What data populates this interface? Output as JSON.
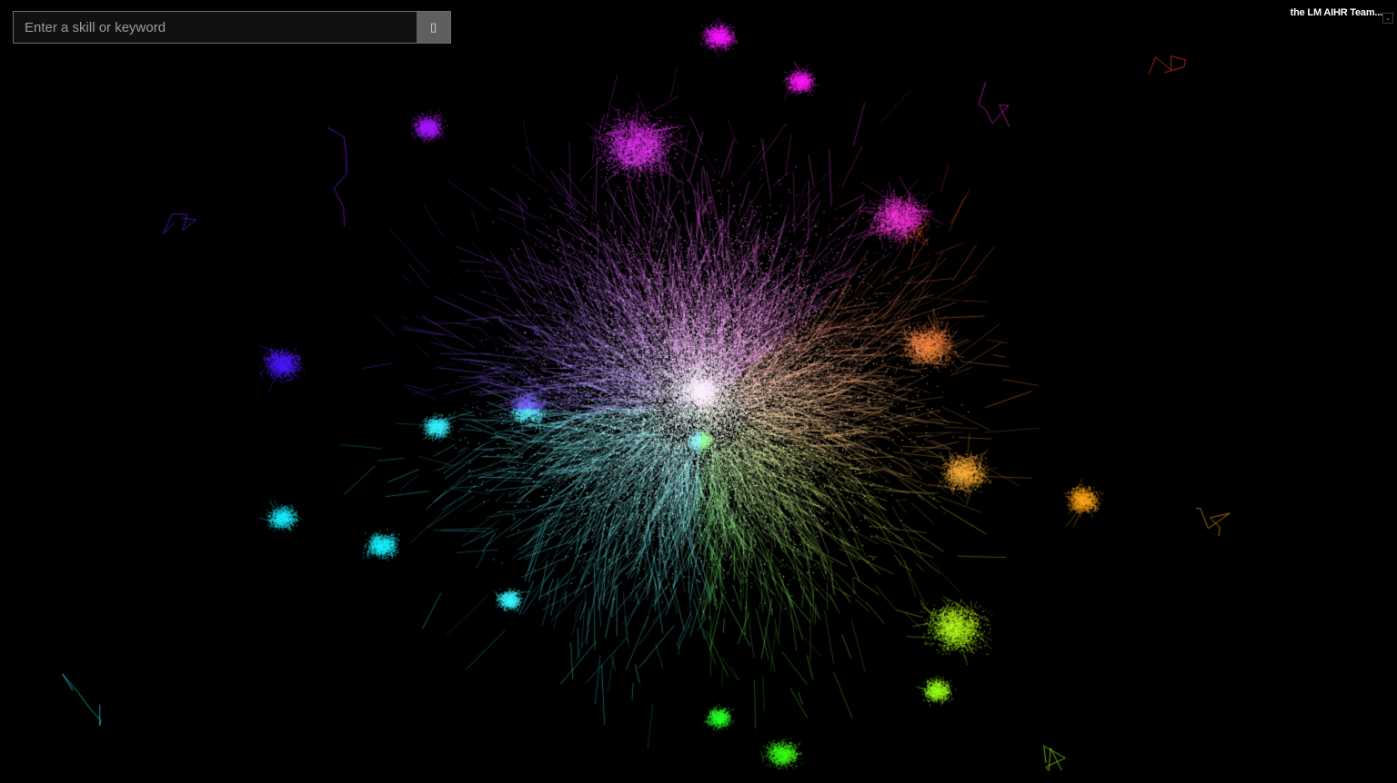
{
  "search": {
    "placeholder": "Enter a skill or keyword",
    "value": "",
    "button_icon": "search-icon",
    "button_glyph": "▯"
  },
  "header": {
    "team_label": "the LM AIHR Team..."
  },
  "corner_icon": {
    "name": "expand-icon",
    "glyph": "⌄"
  },
  "graph": {
    "background": "#000000",
    "palette": [
      "#ff66ff",
      "#b27cff",
      "#6f6bff",
      "#39c8ff",
      "#48ffe6",
      "#ffffff",
      "#d6ffd6",
      "#b9ff8a",
      "#ffe39a",
      "#ffb3a8"
    ]
  }
}
